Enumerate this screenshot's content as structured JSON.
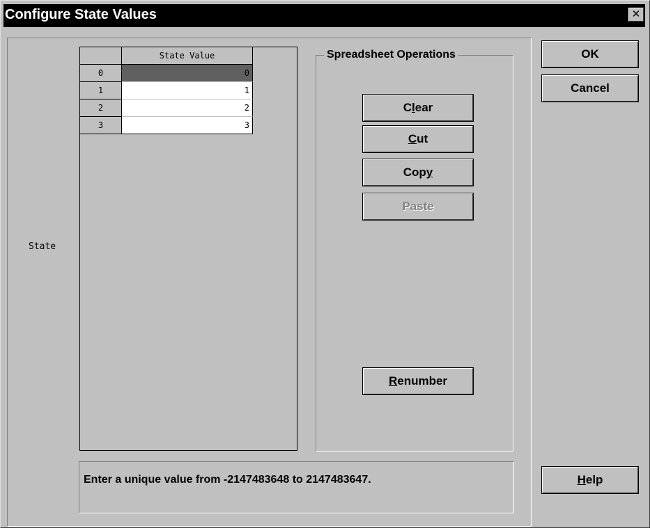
{
  "window": {
    "title": "Configure State Values",
    "close_symbol": "✕"
  },
  "left_label": "State",
  "grid": {
    "column_header": "State Value",
    "rows": [
      {
        "index": "0",
        "value": "0",
        "selected": true
      },
      {
        "index": "1",
        "value": "1",
        "selected": false
      },
      {
        "index": "2",
        "value": "2",
        "selected": false
      },
      {
        "index": "3",
        "value": "3",
        "selected": false
      }
    ]
  },
  "operations": {
    "group_label": "Spreadsheet Operations",
    "clear": {
      "pre": "C",
      "ul": "l",
      "post": "ear"
    },
    "cut": {
      "pre": "",
      "ul": "C",
      "post": "ut"
    },
    "copy": {
      "pre": "Cop",
      "ul": "y",
      "post": ""
    },
    "paste": {
      "pre": "",
      "ul": "P",
      "post": "aste",
      "disabled": true
    },
    "renumber": {
      "pre": "",
      "ul": "R",
      "post": "enumber"
    }
  },
  "buttons": {
    "ok": "OK",
    "cancel": "Cancel",
    "help": {
      "pre": "",
      "ul": "H",
      "post": "elp"
    }
  },
  "status": "Enter a unique value from -2147483648 to 2147483647.",
  "colors": {
    "face": "#c0c0c0",
    "title_bar": "#000000",
    "selected_cell": "#606060"
  }
}
